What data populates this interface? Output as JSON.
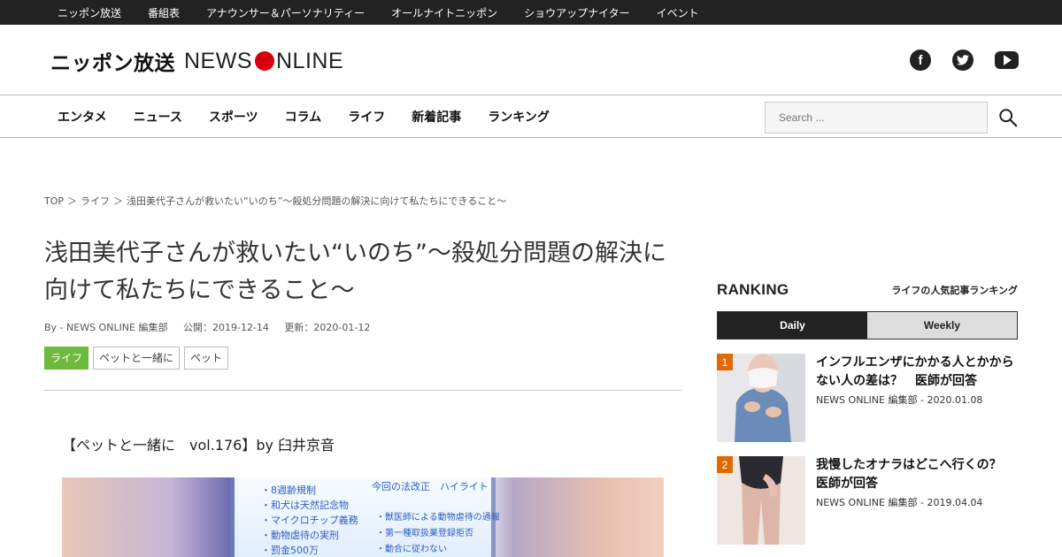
{
  "topbar": {
    "items": [
      "ニッポン放送",
      "番組表",
      "アナウンサー＆パーソナリティー",
      "オールナイトニッポン",
      "ショウアップナイター",
      "イベント"
    ]
  },
  "header": {
    "logo_jp": "ニッポン放送",
    "logo_en_left": "NEWS ",
    "logo_en_right": "NLINE",
    "social": [
      "facebook-icon",
      "twitter-icon",
      "youtube-icon"
    ]
  },
  "nav": {
    "items": [
      "エンタメ",
      "ニュース",
      "スポーツ",
      "コラム",
      "ライフ",
      "新着記事",
      "ランキング"
    ],
    "search_placeholder": "Search ..."
  },
  "breadcrumb": {
    "items": [
      "TOP",
      "＞",
      "ライフ",
      "＞",
      "浅田美代子さんが救いたい“いのち”～殺処分問題の解決に向けて私たちにできること～"
    ]
  },
  "article": {
    "title": "浅田美代子さんが救いたい“いのち”～殺処分問題の解決に向けて私たちにできること～",
    "author": "By - NEWS ONLINE 編集部",
    "published": "公開：2019-12-14",
    "updated": "更新：2020-01-12",
    "tags": [
      "ライフ",
      "ペットと一緒に",
      "ペット"
    ],
    "lead": "【ペットと一緒に　vol.176】by 臼井京音",
    "photo_text": {
      "left": [
        "・8週齢規制",
        "・和犬は天然記念物",
        "・マイクロチップ義務",
        "・動物虐待の実刑",
        "・罰金500万"
      ],
      "right_head": "今回の法改正　ハイライト",
      "right": [
        "・獣医師による動物虐待の通報",
        "・第一種取扱業登録拒否",
        "・動合に従わない"
      ]
    }
  },
  "sidebar": {
    "ranking_title": "RANKING",
    "ranking_sub": "ライフの人気記事ランキング",
    "tab_daily": "Daily",
    "tab_weekly": "Weekly",
    "items": [
      {
        "rank": "1",
        "title": "インフルエンザにかかる人とかからない人の差は？　医師が回答",
        "author": "NEWS ONLINE 編集部",
        "sep": "-",
        "date": "2020.01.08"
      },
      {
        "rank": "2",
        "title": "我慢したオナラはどこへ行くの？　医師が回答",
        "author": "NEWS ONLINE 編集部",
        "sep": "-",
        "date": "2019.04.04"
      }
    ]
  },
  "colors": {
    "topbar_bg": "#222222",
    "logo_dot": "#d8000f",
    "tag_primary": "#6cbb3c",
    "rank_badge": "#e06a00"
  }
}
